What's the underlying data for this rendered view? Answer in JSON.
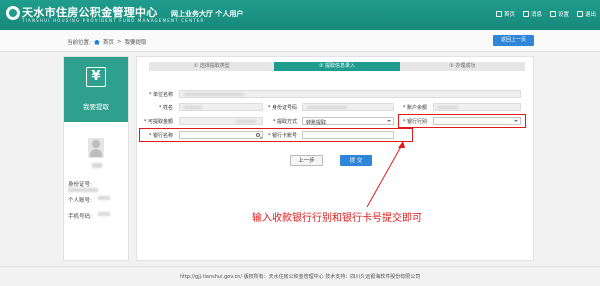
{
  "header": {
    "title": "天水市住房公积金管理中心",
    "subtitle": "TIANSHUI HOUSING PROVIDENT FUND MANAGEMENT CENTER",
    "hall": "网上业务大厅  个人用户",
    "nav": [
      {
        "label": "首页",
        "icon": "home-icon"
      },
      {
        "label": "消息",
        "icon": "mail-icon"
      },
      {
        "label": "设置",
        "icon": "gear-icon"
      },
      {
        "label": "退出",
        "icon": "logout-icon"
      }
    ]
  },
  "breadcrumb": {
    "prefix": "当前位置:",
    "home": "首页",
    "separator": ">",
    "current": "我要提取"
  },
  "back_button": "返回上一页",
  "sidebar": {
    "tile_label": "我要提取",
    "tile_icon": "yen-icon",
    "info": [
      "身份证号:",
      "个人账号:",
      "手机号码:"
    ]
  },
  "steps": [
    {
      "label": "① 选择提取类型",
      "active": false
    },
    {
      "label": "② 提取信息录入",
      "active": true
    },
    {
      "label": "③ 办理成功",
      "active": false
    }
  ],
  "form": {
    "unit_name_label": "* 单位名称",
    "name_label": "* 姓名",
    "id_label": "* 身份证号码",
    "account_label": "* 账户余额",
    "withdrawable_label": "* 可提取金额",
    "method_label": "* 提取方式",
    "method_value": "转账提取",
    "bank_label": "* 银行行别",
    "bank_name_label": "* 银行名称",
    "bank_card_label": "* 银行卡账号"
  },
  "buttons": {
    "prev": "上一步",
    "submit": "提 交"
  },
  "annotation": "输入收款银行行别和银行卡号提交即可",
  "footer": "http://gjj.tianshui.gov.cn/ 版权所有：天水住房公积金管理中心 技术支持：四川久远银海软件股份有限公司",
  "colors": {
    "brand": "#1f9c8d",
    "primary_button": "#2f86d8",
    "annotation": "#e01b1b"
  }
}
